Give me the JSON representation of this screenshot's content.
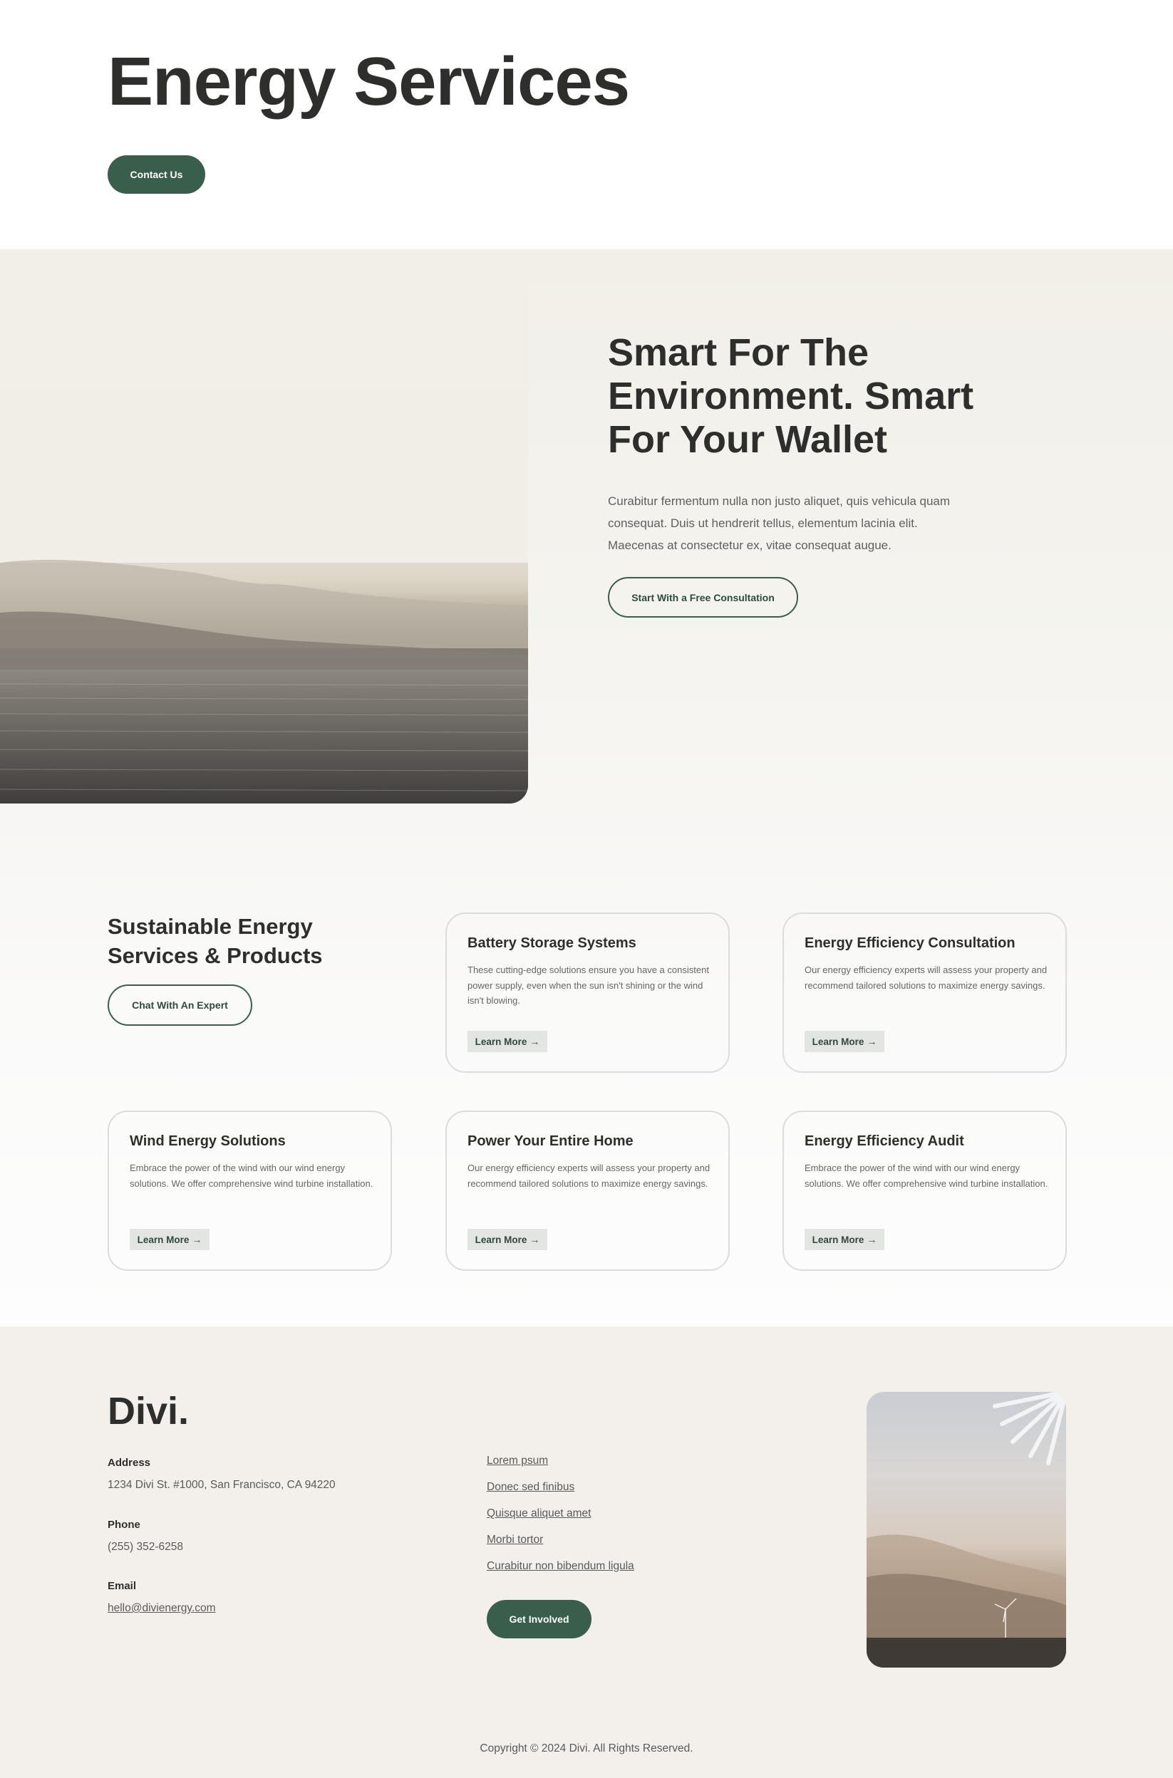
{
  "header": {
    "title": "Energy Services",
    "contact_button": "Contact Us"
  },
  "intro": {
    "heading": "Smart For The Environment. Smart For Your Wallet",
    "text": "Curabitur fermentum nulla non justo aliquet, quis vehicula quam consequat. Duis ut hendrerit tellus, elementum lacinia elit. Maecenas at consectetur ex, vitae consequat augue.",
    "cta_button": "Start With a Free Consultation"
  },
  "services": {
    "heading": "Sustainable Energy Services & Products",
    "cta_button": "Chat With An Expert",
    "cards": [
      {
        "title": "Battery Storage Systems",
        "text": "These cutting-edge solutions ensure you have a consistent power supply, even when the sun isn't shining or the wind isn't blowing.",
        "link": "Learn More"
      },
      {
        "title": "Energy Efficiency Consultation",
        "text": "Our energy efficiency experts will assess your property and recommend tailored solutions to maximize energy savings.",
        "link": "Learn More"
      },
      {
        "title": "Wind Energy Solutions",
        "text": "Embrace the power of the wind with our wind energy solutions. We offer comprehensive wind turbine installation.",
        "link": "Learn More"
      },
      {
        "title": "Power Your Entire Home",
        "text": "Our energy efficiency experts will assess your property and recommend tailored solutions to maximize energy savings.",
        "link": "Learn More"
      },
      {
        "title": "Energy Efficiency Audit",
        "text": "Embrace the power of the wind with our wind energy solutions. We offer comprehensive wind turbine installation.",
        "link": "Learn More"
      }
    ],
    "arrow_icon": "→"
  },
  "footer": {
    "logo": "Divi.",
    "address_label": "Address",
    "address": "1234 Divi St. #1000, San Francisco, CA 94220",
    "phone_label": "Phone",
    "phone": "(255) 352-6258",
    "email_label": "Email",
    "email": "hello@divienergy.com",
    "links": [
      "Lorem psum",
      "Donec sed finibus",
      "Quisque aliquet amet",
      "Morbi tortor",
      "Curabitur non bibendum ligula"
    ],
    "cta_button": "Get Involved",
    "copyright": "Copyright © 2024 Divi. All Rights Reserved."
  },
  "colors": {
    "accent": "#3a5e4c",
    "heading": "#2e2e2c",
    "footer_bg": "#f3f0ec"
  }
}
